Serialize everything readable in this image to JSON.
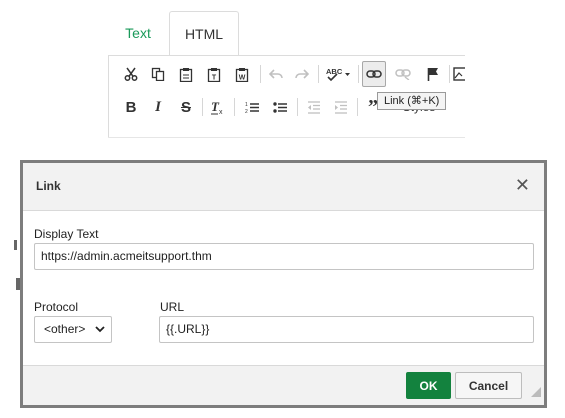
{
  "editor": {
    "tabs": [
      {
        "label": "Text",
        "color": "#1a9a5a"
      },
      {
        "label": "HTML"
      }
    ],
    "toolbar": {
      "row1": [
        {
          "name": "cut-icon",
          "glyph": "✂"
        },
        {
          "name": "copy-icon",
          "glyph": "⧉"
        },
        {
          "name": "paste-icon",
          "glyph": "📋"
        },
        {
          "name": "paste-text-icon",
          "glyph": "📋"
        },
        {
          "name": "paste-word-icon",
          "glyph": "📋"
        },
        {
          "name": "undo-icon",
          "glyph": "↶"
        },
        {
          "name": "redo-icon",
          "glyph": "↷"
        },
        {
          "name": "spellcheck-icon",
          "glyph": "ABC"
        },
        {
          "name": "link-icon",
          "glyph": "🔗"
        },
        {
          "name": "unlink-icon",
          "glyph": "⛓"
        },
        {
          "name": "anchor-flag-icon",
          "glyph": "⚑"
        }
      ],
      "row2": [
        {
          "name": "bold-icon",
          "glyph": "B"
        },
        {
          "name": "italic-icon",
          "glyph": "I"
        },
        {
          "name": "strikethrough-icon",
          "glyph": "S"
        },
        {
          "name": "remove-format-icon",
          "glyph": "Tx"
        },
        {
          "name": "numbered-list-icon",
          "glyph": "≔"
        },
        {
          "name": "bulleted-list-icon",
          "glyph": "•≡"
        },
        {
          "name": "outdent-icon",
          "glyph": "⇤"
        },
        {
          "name": "indent-icon",
          "glyph": "⇥"
        },
        {
          "name": "blockquote-icon",
          "glyph": "❞"
        }
      ],
      "styles_label": "Styles"
    },
    "tooltip": "Link (⌘+K)"
  },
  "dialog": {
    "title": "Link",
    "close_glyph": "✕",
    "display_text": {
      "label": "Display Text",
      "value": "https://admin.acmeitsupport.thm"
    },
    "protocol": {
      "label": "Protocol",
      "selected": "<other>"
    },
    "url": {
      "label": "URL",
      "value": "{{.URL}}"
    },
    "ok_label": "OK",
    "cancel_label": "Cancel",
    "ok_color": "#13823e"
  }
}
